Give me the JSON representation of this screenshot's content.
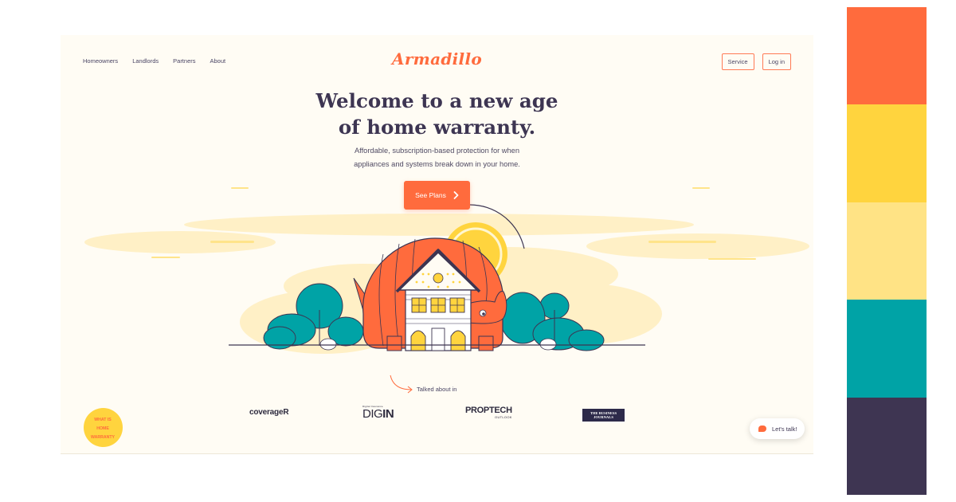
{
  "nav": {
    "links": [
      "Homeowners",
      "Landlords",
      "Partners",
      "About"
    ],
    "logo": "Armadillo",
    "service_label": "Service",
    "login_label": "Log in"
  },
  "hero": {
    "title_line1": "Welcome to a new age",
    "title_line2": "of home warranty.",
    "subtitle_line1": "Affordable, subscription-based protection for when",
    "subtitle_line2": "appliances and systems break down in your home.",
    "cta_label": "See Plans"
  },
  "press": {
    "heading": "Talked about in",
    "coverager": "coverageR",
    "digin_small": "Digital Insurance",
    "digin_part1": "DIG",
    "digin_part2": "IN",
    "proptech": "PROPTECH",
    "proptech_sub": "OUTLOOK",
    "tbj_line1": "THE BUSINESS",
    "tbj_line2": "JOURNALS"
  },
  "badge": {
    "line1": "WHAT IS",
    "line2": "HOME",
    "line3": "WARRANTY"
  },
  "chat": {
    "label": "Let's talk!"
  },
  "colors": {
    "accent": "#ff6b3d",
    "yellow": "#ffd43e",
    "cream": "#fffcf4",
    "dark": "#3d3552",
    "teal": "#00a0a0",
    "palette": [
      "#ff6b3d",
      "#ffd43e",
      "#ffe385",
      "#00a3a6",
      "#3e3552"
    ]
  }
}
